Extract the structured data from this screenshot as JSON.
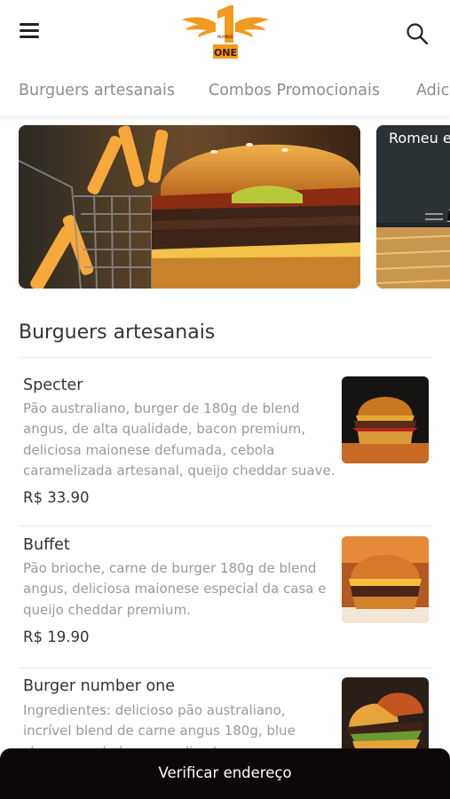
{
  "logo": {
    "line1": "NUMBER",
    "line2": "ONE",
    "numeral": "1"
  },
  "tabs": [
    {
      "label": "Burguers artesanais"
    },
    {
      "label": "Combos Promocionais"
    },
    {
      "label": "Adic"
    }
  ],
  "banners": [
    {
      "label": ""
    },
    {
      "label": "Romeu e"
    }
  ],
  "section": {
    "title": "Burguers artesanais"
  },
  "items": [
    {
      "name": "Specter",
      "desc_lines": [
        "Pão australiano, burger de 180g de blend",
        "angus, de alta qualidade, bacon premium,",
        "deliciosa maionese defumada, cebola",
        "caramelizada artesanal, queijo cheddar suave."
      ],
      "price": "R$ 33.90"
    },
    {
      "name": "Buffet",
      "desc_lines": [
        "Pão brioche, carne de burger 180g de blend",
        "angus, deliciosa maionese especial da casa e",
        "queijo cheddar premium."
      ],
      "price": "R$ 19.90"
    },
    {
      "name": "Burger number one",
      "desc_lines": [
        "Ingredientes: delicioso pão australiano,",
        "incrível blend de carne angus 180g, blue",
        "cheese e cebola caramelizada..."
      ],
      "price": ""
    }
  ],
  "bottom_bar": {
    "label": "Verificar endereço"
  },
  "colors": {
    "brand": "#f29a1e",
    "bar": "#0d0606",
    "muted": "#9a9a9a"
  }
}
